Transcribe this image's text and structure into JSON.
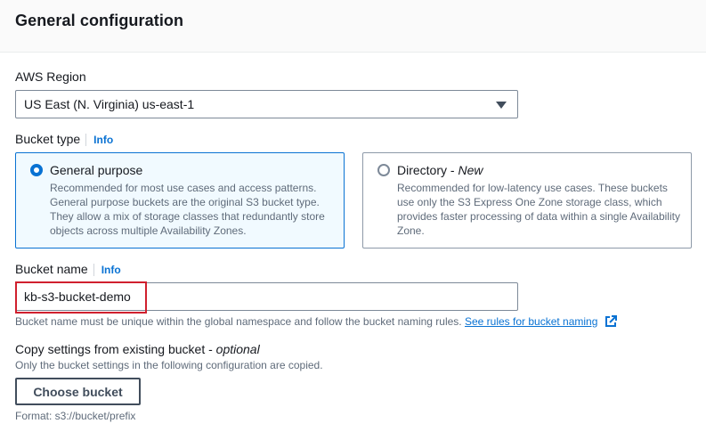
{
  "header": {
    "title": "General configuration"
  },
  "region": {
    "label": "AWS Region",
    "selected": "US East (N. Virginia) us-east-1"
  },
  "bucket_type": {
    "label": "Bucket type",
    "info": "Info",
    "options": [
      {
        "title": "General purpose",
        "title_suffix": "",
        "description": "Recommended for most use cases and access patterns. General purpose buckets are the original S3 bucket type. They allow a mix of storage classes that redundantly store objects across multiple Availability Zones.",
        "selected": true
      },
      {
        "title": "Directory - ",
        "title_suffix": "New",
        "description": "Recommended for low-latency use cases. These buckets use only the S3 Express One Zone storage class, which provides faster processing of data within a single Availability Zone.",
        "selected": false
      }
    ]
  },
  "bucket_name": {
    "label": "Bucket name",
    "info": "Info",
    "value": "kb-s3-bucket-demo",
    "hint": "Bucket name must be unique within the global namespace and follow the bucket naming rules.",
    "link": "See rules for bucket naming"
  },
  "copy_settings": {
    "label": "Copy settings from existing bucket - ",
    "label_optional": "optional",
    "hint": "Only the bucket settings in the following configuration are copied.",
    "button": "Choose bucket",
    "format": "Format: s3://bucket/prefix"
  },
  "colors": {
    "accent": "#0972d3",
    "highlight": "#d0202e",
    "text": "#16191f",
    "secondary_text": "#5f6b7a"
  }
}
